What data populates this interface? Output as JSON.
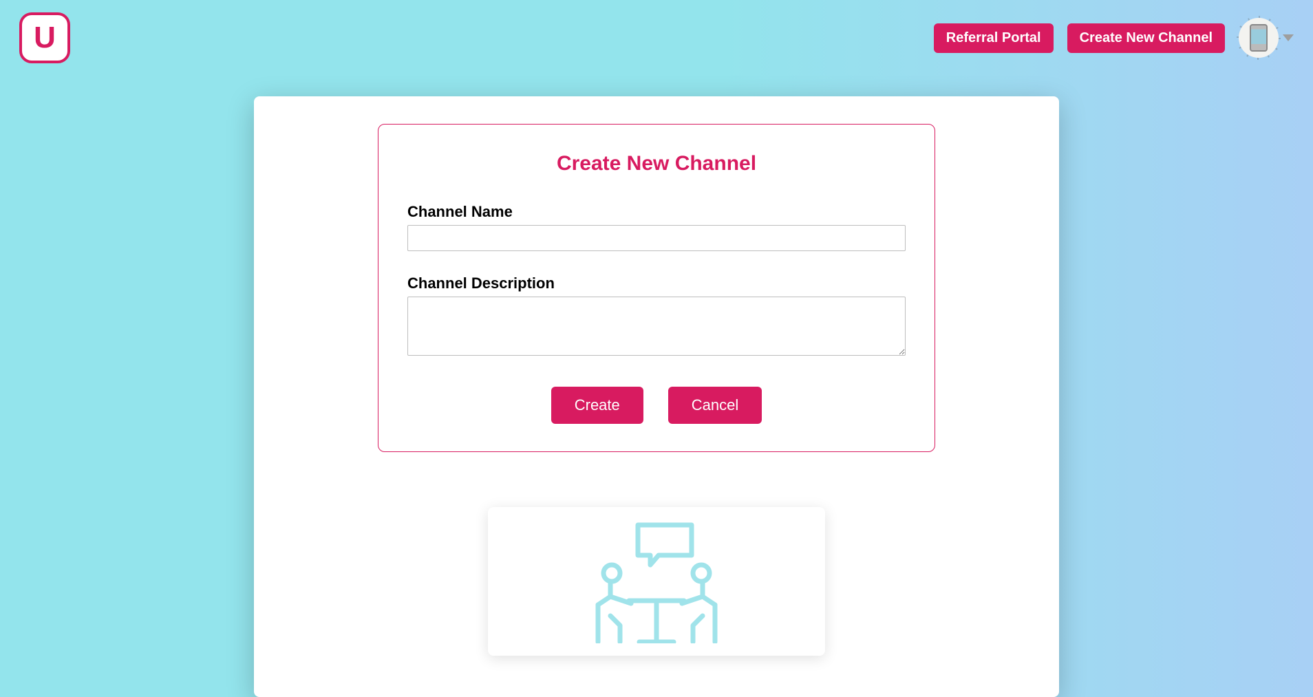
{
  "colors": {
    "accent": "#d81b60",
    "illus_stroke": "#a0e3ea"
  },
  "header": {
    "logo_letter": "U",
    "referral_label": "Referral Portal",
    "create_channel_label": "Create New Channel"
  },
  "form": {
    "title": "Create New Channel",
    "name_label": "Channel Name",
    "name_value": "",
    "desc_label": "Channel Description",
    "desc_value": "",
    "create_label": "Create",
    "cancel_label": "Cancel"
  }
}
